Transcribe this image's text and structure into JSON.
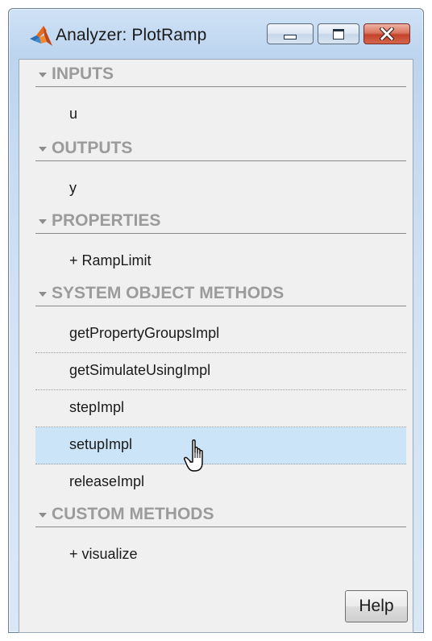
{
  "window": {
    "title": "Analyzer: PlotRamp"
  },
  "sections": {
    "inputs": {
      "label": "INPUTS",
      "items": [
        "u"
      ]
    },
    "outputs": {
      "label": "OUTPUTS",
      "items": [
        "y"
      ]
    },
    "properties": {
      "label": "PROPERTIES",
      "items": [
        "+ RampLimit"
      ]
    },
    "system_object_methods": {
      "label": "SYSTEM OBJECT METHODS",
      "items": [
        "getPropertyGroupsImpl",
        "getSimulateUsingImpl",
        "stepImpl",
        "setupImpl",
        "releaseImpl"
      ],
      "selected": "setupImpl"
    },
    "custom_methods": {
      "label": "CUSTOM METHODS",
      "items": [
        "+ visualize"
      ]
    }
  },
  "buttons": {
    "help": "Help"
  },
  "icons": {
    "app": "matlab-logo-icon",
    "cursor": "hand-pointer-icon",
    "minimize": "minimize-icon",
    "maximize": "maximize-icon",
    "close": "close-icon",
    "section_toggle": "triangle-down-icon"
  },
  "colors": {
    "selection": "#cce4f7",
    "section_label": "#9b9b9b",
    "close_button": "#c4432b"
  }
}
